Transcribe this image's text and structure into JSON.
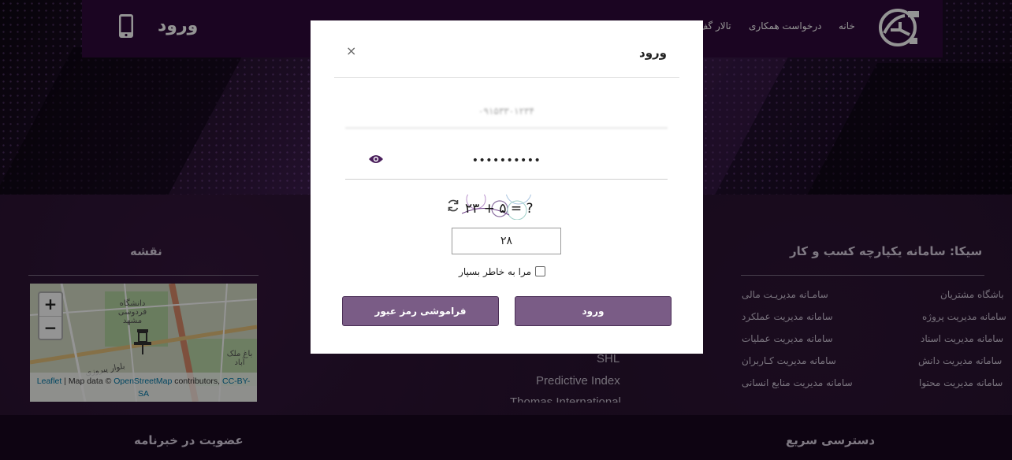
{
  "header": {
    "login_link": "ورود",
    "nav": [
      "خانه",
      "درخواست همکاری",
      "تالار گف"
    ]
  },
  "footer": {
    "sika_title": "سیکا: سامانه یکپارچه کسب و کار",
    "links_right": [
      "باشگاه مشتریان",
      "سامانه مدیریت پروژه",
      "سامانه مدیریت اسناد",
      "سامانه مدیریت دانش",
      "سامانه مدیریت محتوا"
    ],
    "links_left": [
      "سامـانه مدیریـت مالی",
      "سامانه مدیریت عملکرد",
      "سامانه مدیریت عملیات",
      "سامانه مدیریت کـاربران",
      "سامانه مدیریت منابع انسانی"
    ],
    "english_links": [
      "SHL",
      "Predictive Index",
      "Thomas International"
    ],
    "map_title": "نقشه",
    "quick_access": "دسترسی سریع",
    "newsletter": "عضویت در خبرنامه"
  },
  "map": {
    "zoom_in": "+",
    "zoom_out": "−",
    "labels": [
      "دانشگاه فردوسی مشهد",
      "باغ ملک آباد",
      "بلوار پیروزی"
    ],
    "attrib_leaflet": "Leaflet",
    "attrib_mid": " | Map data © ",
    "attrib_osm": "OpenStreetMap",
    "attrib_contrib": " contributors, ",
    "attrib_license": "CC-BY-SA"
  },
  "modal": {
    "title": "ورود",
    "close": "×",
    "username_value": "۰۹۱۵۳۳۰۱۲۳۴",
    "password_value": "••••••••••",
    "captcha_text": "۲۳ + ۵ = ?",
    "captcha_answer": "۲۸",
    "remember_label": "مرا به خاطر بسپار",
    "login_button": "ورود",
    "forgot_button": "فراموشی رمز عبور"
  },
  "colors": {
    "header_bg": "#300a3c",
    "button_bg": "#7a5c86",
    "footer_bg": "#24102b"
  }
}
